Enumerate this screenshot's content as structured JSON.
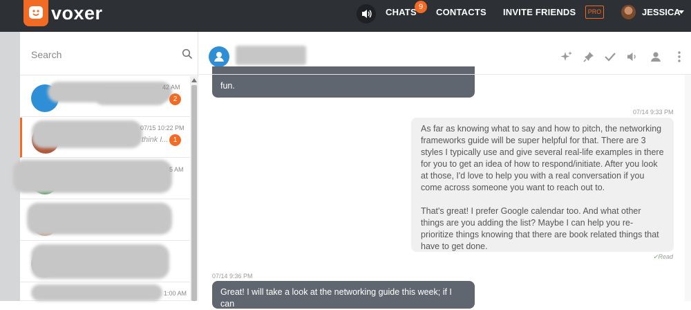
{
  "app": {
    "brand": "voxer",
    "accent": "#f26b25",
    "topbar_bg": "#2d3035"
  },
  "nav": {
    "chats": "CHATS",
    "chats_badge": "9",
    "contacts": "CONTACTS",
    "invite": "INVITE FRIENDS",
    "pro": "PRO",
    "user": "JESSICA"
  },
  "search": {
    "placeholder": "Search"
  },
  "conversations": [
    {
      "time": "42 AM",
      "badge": "2",
      "preview": ""
    },
    {
      "time": "07/15 10:22 PM",
      "badge": "1",
      "preview": "think I..."
    },
    {
      "time": "5 AM",
      "badge": "",
      "preview": ""
    },
    {
      "time": "",
      "badge": "",
      "preview": ""
    },
    {
      "time": "",
      "badge": "",
      "preview": ""
    },
    {
      "time": "1:00 AM",
      "badge": "",
      "preview": ""
    }
  ],
  "chat": {
    "messages": [
      {
        "direction": "in",
        "text": "fun."
      },
      {
        "direction": "out",
        "timestamp": "07/14 9:33 PM",
        "paragraph1": "As far as knowing what to say and how to pitch, the networking frameworks guide will be super helpful for that. There are 3 styles I typically use and give several real-life examples in there for you to get an idea of how to respond/initiate. After you look at those, I'd love to help you with a real conversation if you come across someone you want to reach out to.",
        "paragraph2": "That's great! I prefer Google calendar too. And what other things are you adding the list? Maybe I can help you re-prioritize things knowing that there are book related things that have to get done.",
        "status": "Read"
      },
      {
        "direction": "in",
        "timestamp": "07/14 9:36 PM",
        "text": "Great! I will take a look at the networking guide this week; if I can"
      }
    ]
  }
}
